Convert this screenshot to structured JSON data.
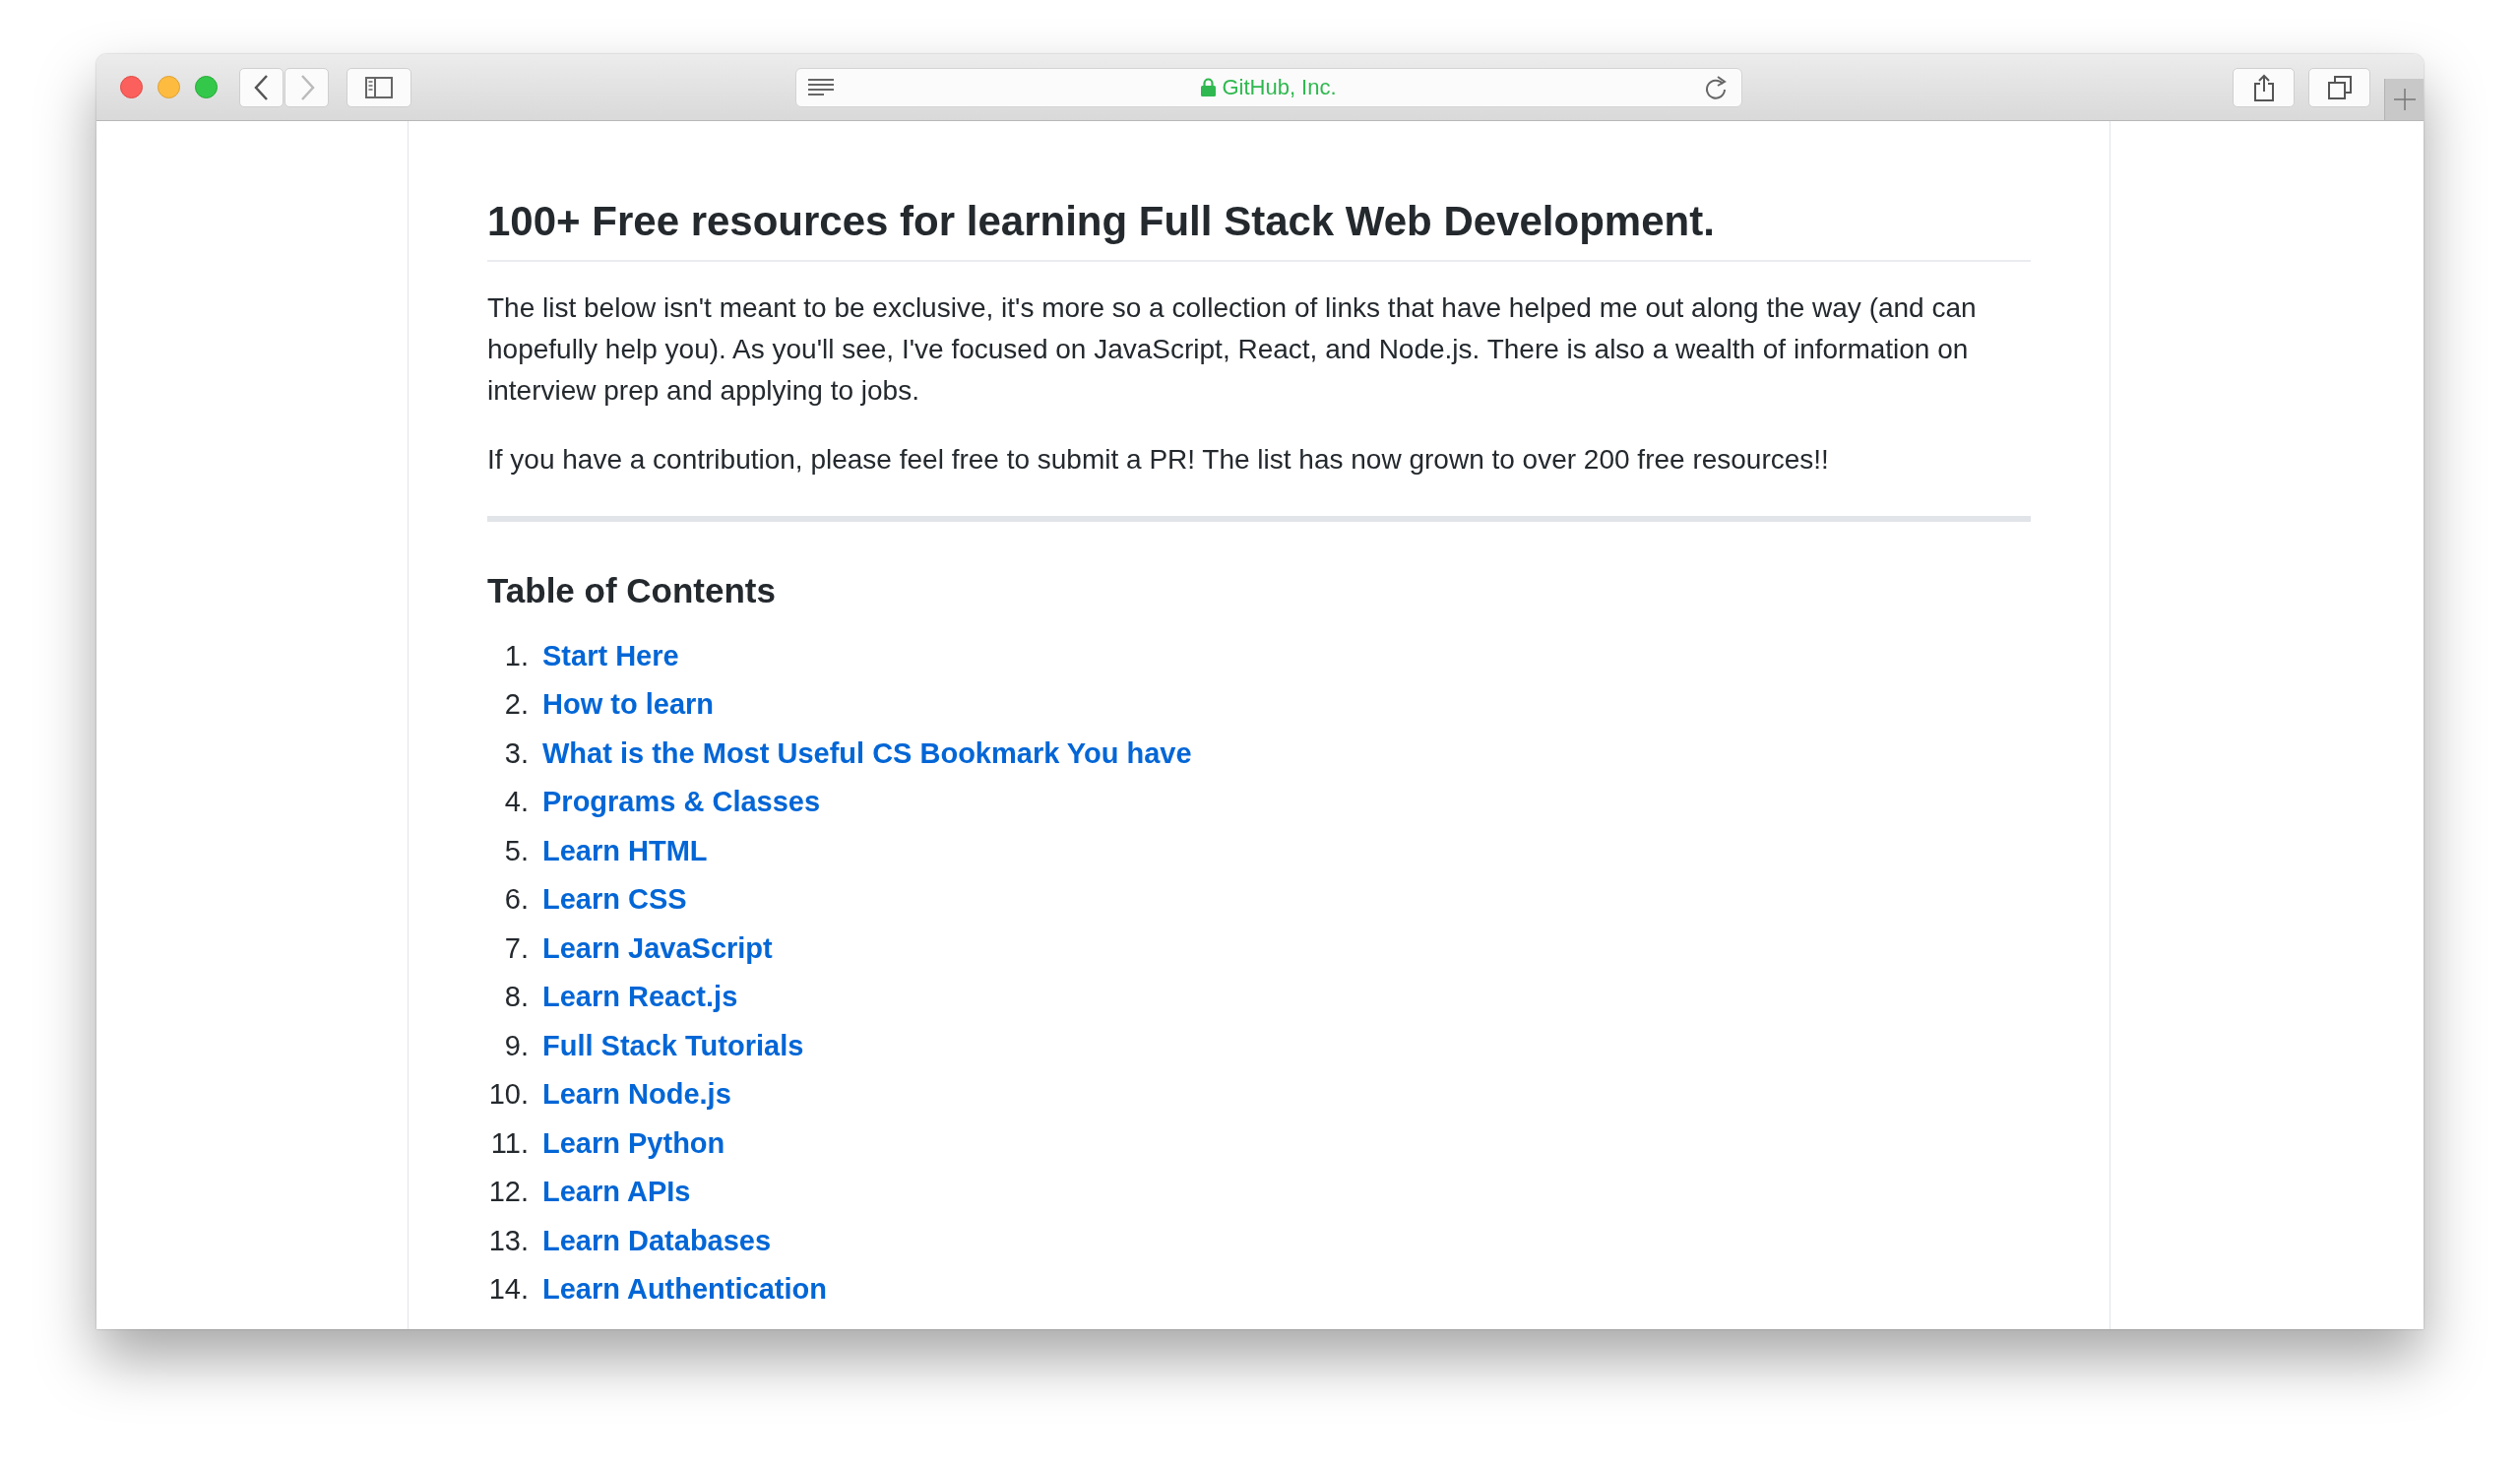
{
  "browser": {
    "address": "GitHub, Inc.",
    "secure": true,
    "back_enabled": true,
    "forward_enabled": false
  },
  "article": {
    "title": "100+ Free resources for learning Full Stack Web Development.",
    "paragraphs": [
      "The list below isn't meant to be exclusive, it's more so a collection of links that have helped me out along the way (and can hopefully help you). As you'll see, I've focused on JavaScript, React, and Node.js. There is also a wealth of information on interview prep and applying to jobs.",
      "If you have a contribution, please feel free to submit a PR! The list has now grown to over 200 free resources!!"
    ],
    "toc_title": "Table of Contents",
    "toc": [
      {
        "number": "1.",
        "label": "Start Here"
      },
      {
        "number": "2.",
        "label": "How to learn"
      },
      {
        "number": "3.",
        "label": "What is the Most Useful CS Bookmark You have"
      },
      {
        "number": "4.",
        "label": "Programs & Classes"
      },
      {
        "number": "5.",
        "label": "Learn HTML"
      },
      {
        "number": "6.",
        "label": "Learn CSS"
      },
      {
        "number": "7.",
        "label": "Learn JavaScript"
      },
      {
        "number": "8.",
        "label": "Learn React.js"
      },
      {
        "number": "9.",
        "label": "Full Stack Tutorials"
      },
      {
        "number": "10.",
        "label": "Learn Node.js"
      },
      {
        "number": "11.",
        "label": "Learn Python"
      },
      {
        "number": "12.",
        "label": "Learn APIs"
      },
      {
        "number": "13.",
        "label": "Learn Databases"
      },
      {
        "number": "14.",
        "label": "Learn Authentication"
      }
    ]
  }
}
